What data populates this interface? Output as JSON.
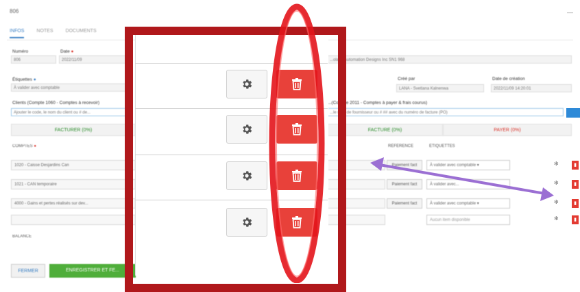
{
  "window": {
    "title": "806",
    "close": "—"
  },
  "tabs": [
    {
      "label": "INFOS",
      "active": true
    },
    {
      "label": "NOTES",
      "active": false
    },
    {
      "label": "DOCUMENTS",
      "active": false
    }
  ],
  "form": {
    "numero": {
      "label": "Numéro",
      "value": "806"
    },
    "date": {
      "label": "Date",
      "value": "2022/11/09"
    },
    "name_value": "...olaire Automation Designs Inc SN1 968",
    "etiquettes": {
      "label": "Étiquettes",
      "value": "À valider avec comptable"
    },
    "cree_par": {
      "label": "Créé par",
      "value": "LANA - Svetlana Kalnenwa"
    },
    "date_creation": {
      "label": "Date de création",
      "value": "2022/11/09 14:20:01"
    },
    "client": {
      "label": "Clients (Compte 1060 - Comptes à recevoir)",
      "placeholder": "Ajouter le code, le nom du client ou # de..."
    },
    "fournisseur": {
      "label": "...(Compte 2011 - Comptes à payer & frais courus)",
      "placeholder": "...le nom de fournisseur ou # ## avec du numéro de facture (PO)"
    }
  },
  "bars": {
    "facturer": "FACTURER (0%)",
    "facture": "FACTURE (0%)",
    "payer": "PAYER (0%)"
  },
  "table": {
    "headers": {
      "comptes": "COMPTES",
      "reference": "RÉFÉRENCE",
      "etiquettes": "ÉTIQUETTES"
    },
    "rows": [
      {
        "account": "1020 - Caisse Desjardins Can",
        "ref": "Paiement fact",
        "tag": "À valider avec comptable"
      },
      {
        "account": "1021 - CAN temporaire",
        "ref": "Paiement fact",
        "tag": "À valider avec..."
      },
      {
        "account": "4000 - Gains et pertes réalisés sur dev...",
        "ref": "Paiement fact",
        "tag": "À valider avec comptable"
      },
      {
        "account": "",
        "ref": "",
        "tag": "Aucun item disponible"
      }
    ],
    "balance_label": "BALANCE"
  },
  "buttons": {
    "fermer": "FERMER",
    "enregistrer": "ENREGISTRER ET FE..."
  },
  "colors": {
    "accent_blue": "#3a7fc4",
    "green": "#4fae3a",
    "delete_red": "#e8413a",
    "frame_red": "#b0181b",
    "arrow_purple": "#9b6fd3"
  },
  "icons": {
    "gear": "gear-icon",
    "trash": "trash-icon",
    "required": "required-icon"
  }
}
